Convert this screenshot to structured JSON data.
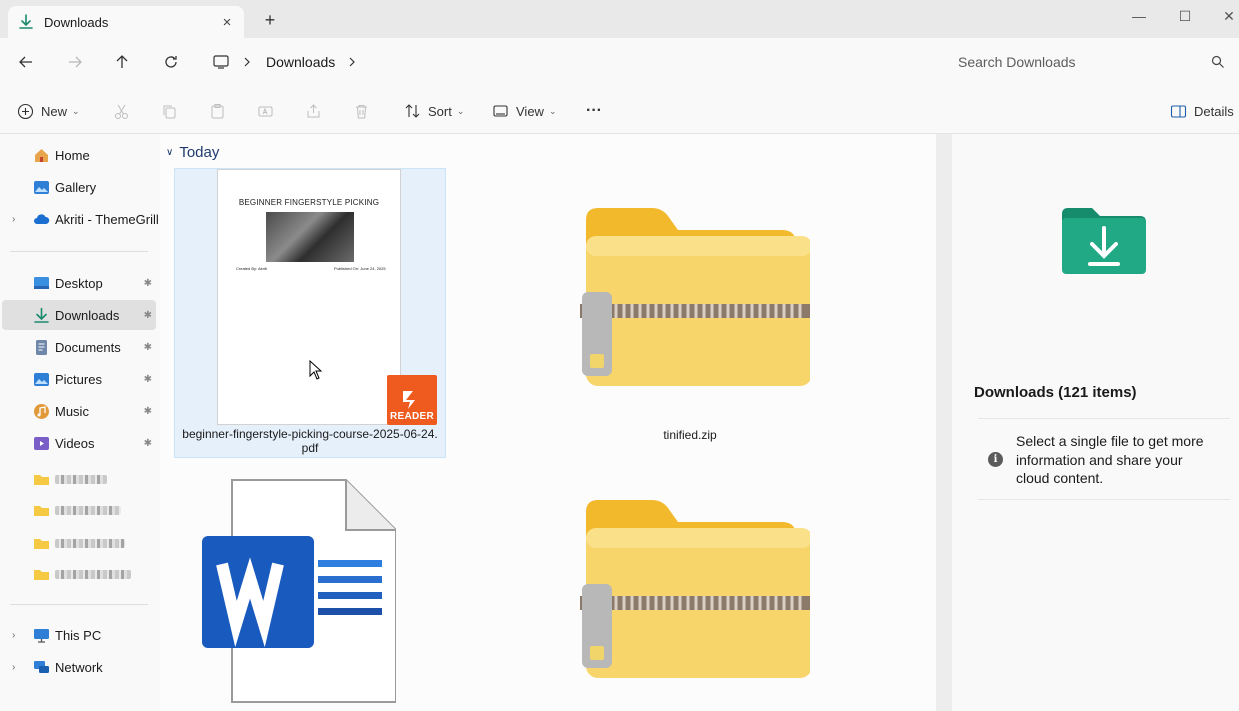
{
  "window": {
    "tab_title": "Downloads",
    "tab_close_icon": "×",
    "new_tab_icon": "+",
    "minimize_icon": "—",
    "maximize_icon": "☐",
    "close_icon": "✕"
  },
  "navigation": {
    "address_segment": "Downloads",
    "search_placeholder": "Search Downloads"
  },
  "toolbar": {
    "new_label": "New",
    "sort_label": "Sort",
    "view_label": "View",
    "more_label": "···",
    "details_label": "Details",
    "caret": "⌄"
  },
  "sidebar": {
    "home": "Home",
    "gallery": "Gallery",
    "onedrive": "Akriti - ThemeGrill",
    "desktop": "Desktop",
    "downloads": "Downloads",
    "documents": "Documents",
    "pictures": "Pictures",
    "music": "Music",
    "videos": "Videos",
    "this_pc": "This PC",
    "network": "Network",
    "pin_icon": "📌"
  },
  "content": {
    "group_label": "Today",
    "files": [
      {
        "name": "beginner-fingerstyle-picking-course-2025-06-24.pdf",
        "name_line1": "beginner-fingerstyle-picking-course-2025-06-24.",
        "name_line2": "pdf",
        "type": "pdf"
      },
      {
        "name": "tinified.zip",
        "type": "zip"
      },
      {
        "name": "",
        "type": "docx"
      },
      {
        "name": "",
        "type": "zip"
      }
    ],
    "pdf_preview": {
      "title": "BEGINNER FINGERSTYLE PICKING",
      "meta_left": "Created By: Akriti",
      "meta_right": "Published On: June 24, 2025",
      "badge": "READER"
    }
  },
  "details_pane": {
    "title": "Downloads (121 items)",
    "info_text": "Select a single file to get more information and share your cloud content.",
    "info_icon": "i"
  },
  "colors": {
    "accent": "#1a7f64",
    "selection": "#e5f0fb",
    "folder_yellow": "#f8d56b",
    "word_blue": "#185abd",
    "reader_orange": "#ef5a1f"
  }
}
